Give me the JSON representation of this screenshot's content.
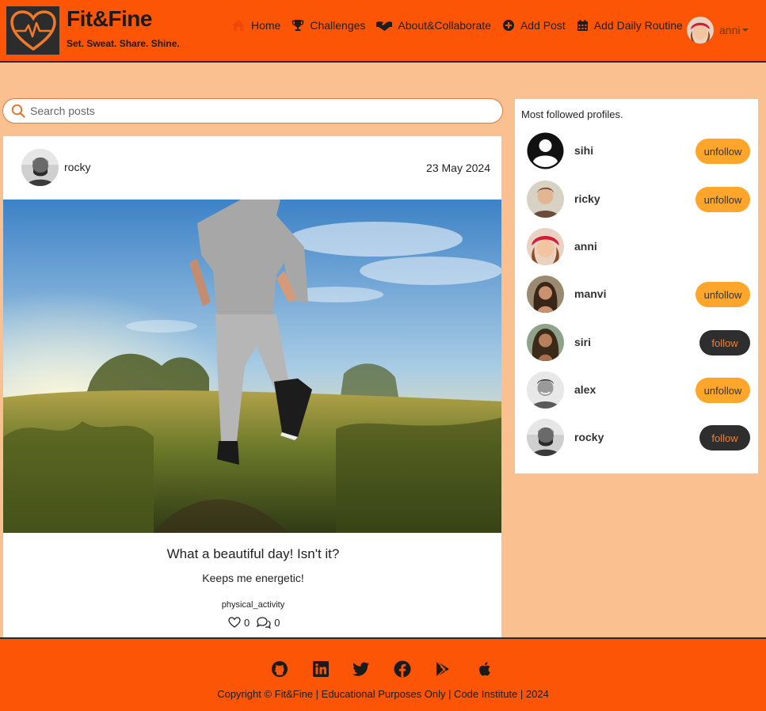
{
  "brand": {
    "title": "Fit&Fine",
    "tagline": "Set. Sweat. Share. Shine."
  },
  "nav": {
    "links": [
      {
        "label": "Home",
        "icon": "home-icon"
      },
      {
        "label": "Challenges",
        "icon": "trophy-icon"
      },
      {
        "label": "About&Collaborate",
        "icon": "handshake-icon"
      },
      {
        "label": "Add Post",
        "icon": "plus-circle-icon"
      },
      {
        "label": "Add Daily Routine",
        "icon": "calendar-icon"
      }
    ],
    "user": {
      "name": "anni"
    }
  },
  "search": {
    "placeholder": "Search posts",
    "value": ""
  },
  "post": {
    "author": "rocky",
    "date": "23 May 2024",
    "title": "What a beautiful day! Isn't it?",
    "body": "Keeps me energetic!",
    "tag": "physical_activity",
    "likes": "0",
    "comments": "0"
  },
  "sidebar": {
    "title": "Most followed profiles.",
    "profiles": [
      {
        "name": "sihi",
        "action": "unfollow"
      },
      {
        "name": "ricky",
        "action": "unfollow"
      },
      {
        "name": "anni",
        "action": ""
      },
      {
        "name": "manvi",
        "action": "unfollow"
      },
      {
        "name": "siri",
        "action": "follow"
      },
      {
        "name": "alex",
        "action": "unfollow"
      },
      {
        "name": "rocky",
        "action": "follow"
      }
    ]
  },
  "footer": {
    "icons": [
      "github-icon",
      "linkedin-icon",
      "twitter-icon",
      "facebook-icon",
      "google-play-icon",
      "apple-icon"
    ],
    "copyright": "Copyright © Fit&Fine | Educational Purposes Only | Code Institute | 2024"
  },
  "colors": {
    "accent": "#fd5506",
    "background": "#fbc08f",
    "unfollow_button": "#fea62c",
    "follow_button": "#2e2e2e"
  }
}
